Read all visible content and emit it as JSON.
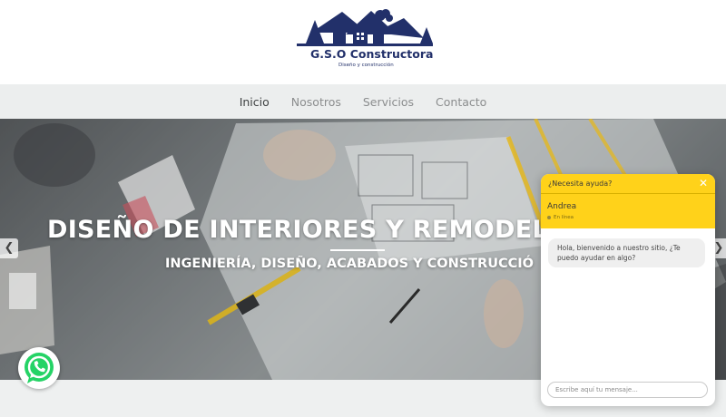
{
  "brand": {
    "name": "G.S.O Constructora",
    "tagline": "Diseño y construcción",
    "color": "#22306a"
  },
  "nav": {
    "items": [
      {
        "label": "Inicio",
        "active": true
      },
      {
        "label": "Nosotros",
        "active": false
      },
      {
        "label": "Servicios",
        "active": false
      },
      {
        "label": "Contacto",
        "active": false
      }
    ]
  },
  "hero": {
    "title": "DISEÑO DE INTERIORES Y REMODEL",
    "subtitle": "INGENIERÍA, DISEÑO, ACABADOS Y CONSTRUCCIÓ",
    "prev_icon": "chevron-left-icon",
    "next_icon": "chevron-right-icon"
  },
  "chat": {
    "header_title": "¿Necesita ayuda?",
    "close_icon": "close-icon",
    "agent_name": "Andrea",
    "agent_status": "En línea",
    "message": "Hola, bienvenido a nuestro sitio, ¿Te puedo ayudar en algo?",
    "input_placeholder": "Escribe aquí tu mensaje...",
    "accent_color": "#ffd21a"
  },
  "whatsapp": {
    "icon": "whatsapp-icon",
    "color": "#25d366"
  }
}
